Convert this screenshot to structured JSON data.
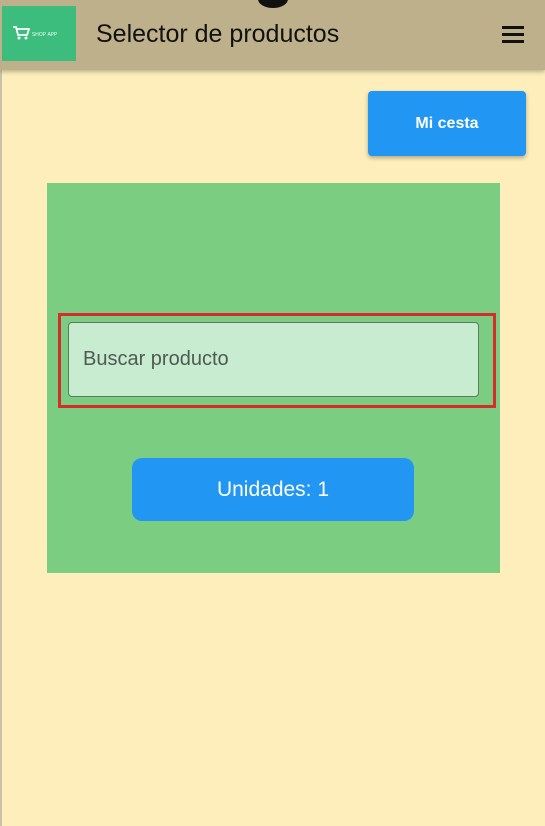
{
  "appbar": {
    "title": "Selector de productos",
    "logo_text": "SHOP APP",
    "logo_icon": "shopping-cart-icon",
    "menu_icon": "hamburger-menu-icon"
  },
  "actions": {
    "cart_label": "Mi cesta"
  },
  "search": {
    "placeholder": "Buscar producto",
    "value": ""
  },
  "units": {
    "label": "Unidades: 1"
  },
  "colors": {
    "appbar": "#bdb08a",
    "background": "#fdeebb",
    "panel": "#7bcd82",
    "primary": "#2196f3",
    "highlight": "#d72c2c",
    "logo": "#3dbd7d"
  }
}
